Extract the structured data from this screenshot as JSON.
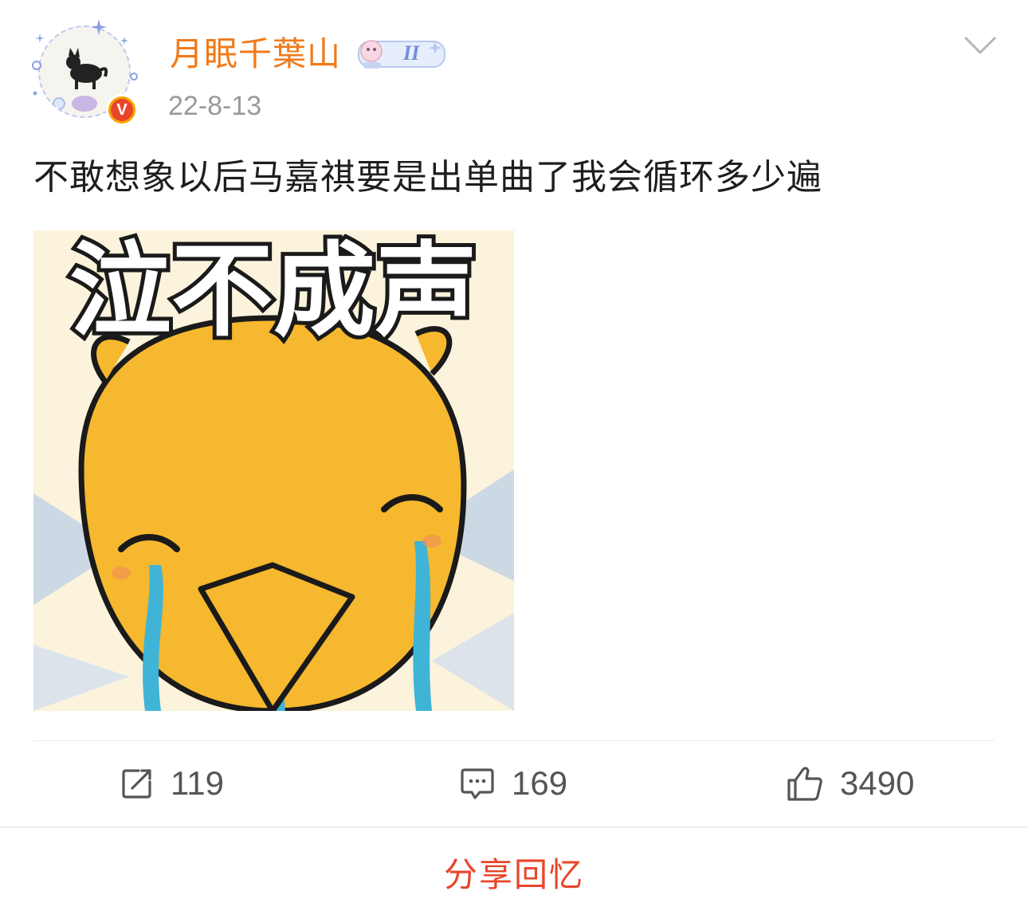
{
  "post": {
    "author": {
      "name": "月眠千葉山",
      "verified_badge_letter": "V",
      "member_badge_text": "II"
    },
    "date": "22-8-13",
    "text": "不敢想象以后马嘉祺要是出单曲了我会循环多少遍",
    "image": {
      "caption_text": "泣不成声"
    }
  },
  "actions": {
    "repost_count": "119",
    "comment_count": "169",
    "like_count": "3490"
  },
  "footer": {
    "share_memory_label": "分享回忆"
  },
  "icons": {
    "menu": "chevron-down-icon",
    "repost": "repost-icon",
    "comment": "comment-icon",
    "like": "thumbs-up-icon"
  },
  "colors": {
    "username": "#f07a1a",
    "share_label": "#e8462b",
    "date": "#9a9a9a",
    "meme_yellow": "#f5b82e"
  }
}
